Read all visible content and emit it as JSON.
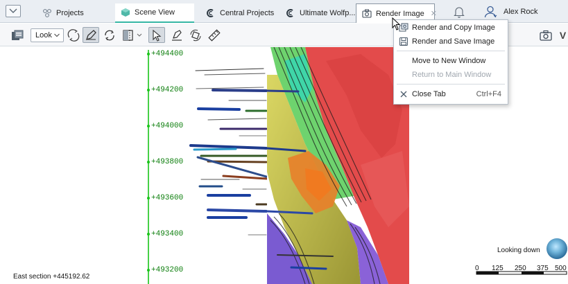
{
  "tabs": [
    {
      "label": "Projects",
      "icon": "projects-icon"
    },
    {
      "label": "Scene View",
      "icon": "scene-view-icon"
    },
    {
      "label": "Central Projects",
      "icon": "central-icon"
    },
    {
      "label": "Ultimate Wolfp...",
      "icon": "central-icon"
    },
    {
      "label": "Render Image",
      "icon": "camera-icon"
    }
  ],
  "user": {
    "name": "Alex Rock"
  },
  "toolbar": {
    "look_label": "Look"
  },
  "context_menu": {
    "items": [
      {
        "label": "Render and Copy Image",
        "shortcut": "",
        "disabled": false,
        "icon": "render-copy-icon"
      },
      {
        "label": "Render and Save Image",
        "shortcut": "",
        "disabled": false,
        "icon": "save-icon"
      },
      {
        "label": "Move to New Window",
        "shortcut": "",
        "disabled": false,
        "icon": ""
      },
      {
        "label": "Return to Main Window",
        "shortcut": "",
        "disabled": true,
        "icon": ""
      },
      {
        "label": "Close Tab",
        "shortcut": "Ctrl+F4",
        "disabled": false,
        "icon": "close-icon"
      }
    ]
  },
  "viewport": {
    "northing_labels": [
      "+494400",
      "+494200",
      "+494000",
      "+493800",
      "+493600",
      "+493400",
      "+493200"
    ],
    "section_label": "East section +445192.62",
    "looking": "Looking down",
    "scale_labels": [
      "0",
      "125",
      "250",
      "375",
      "500"
    ]
  },
  "colors": {
    "accent_teal": "#35b6a4",
    "grid_green": "#19c419",
    "surface_red": "#e04848",
    "surface_green": "#6fd36f",
    "surface_yellow": "#b9b530",
    "surface_purple": "#7a5bd1"
  }
}
